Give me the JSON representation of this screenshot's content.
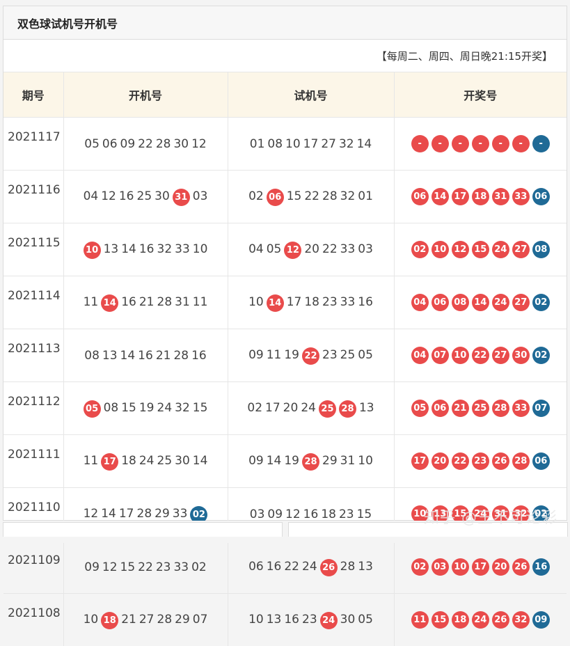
{
  "title": "双色球试机号开机号",
  "notice": "【每周二、周四、周日晚21:15开奖】",
  "headers": [
    "期号",
    "开机号",
    "试机号",
    "开奖号"
  ],
  "rows": [
    {
      "issue": "2021117",
      "kaiji": [
        {
          "n": "05"
        },
        {
          "n": "06"
        },
        {
          "n": "09"
        },
        {
          "n": "22"
        },
        {
          "n": "28"
        },
        {
          "n": "30"
        },
        {
          "n": "12"
        }
      ],
      "shiji": [
        {
          "n": "01"
        },
        {
          "n": "08"
        },
        {
          "n": "10"
        },
        {
          "n": "17"
        },
        {
          "n": "27"
        },
        {
          "n": "32"
        },
        {
          "n": "14"
        }
      ],
      "kaijiang": [
        "-",
        "-",
        "-",
        "-",
        "-",
        "-"
      ],
      "blue": "-"
    },
    {
      "issue": "2021116",
      "kaiji": [
        {
          "n": "04"
        },
        {
          "n": "12"
        },
        {
          "n": "16"
        },
        {
          "n": "25"
        },
        {
          "n": "30"
        },
        {
          "n": "31",
          "h": "red"
        },
        {
          "n": "03"
        }
      ],
      "shiji": [
        {
          "n": "02"
        },
        {
          "n": "06",
          "h": "red"
        },
        {
          "n": "15"
        },
        {
          "n": "22"
        },
        {
          "n": "28"
        },
        {
          "n": "32"
        },
        {
          "n": "01"
        }
      ],
      "kaijiang": [
        "06",
        "14",
        "17",
        "18",
        "31",
        "33"
      ],
      "blue": "06"
    },
    {
      "issue": "2021115",
      "kaiji": [
        {
          "n": "10",
          "h": "red"
        },
        {
          "n": "13"
        },
        {
          "n": "14"
        },
        {
          "n": "16"
        },
        {
          "n": "32"
        },
        {
          "n": "33"
        },
        {
          "n": "10"
        }
      ],
      "shiji": [
        {
          "n": "04"
        },
        {
          "n": "05"
        },
        {
          "n": "12",
          "h": "red"
        },
        {
          "n": "20"
        },
        {
          "n": "22"
        },
        {
          "n": "33"
        },
        {
          "n": "03"
        }
      ],
      "kaijiang": [
        "02",
        "10",
        "12",
        "15",
        "24",
        "27"
      ],
      "blue": "08"
    },
    {
      "issue": "2021114",
      "kaiji": [
        {
          "n": "11"
        },
        {
          "n": "14",
          "h": "red"
        },
        {
          "n": "16"
        },
        {
          "n": "21"
        },
        {
          "n": "28"
        },
        {
          "n": "31"
        },
        {
          "n": "11"
        }
      ],
      "shiji": [
        {
          "n": "10"
        },
        {
          "n": "14",
          "h": "red"
        },
        {
          "n": "17"
        },
        {
          "n": "18"
        },
        {
          "n": "23"
        },
        {
          "n": "33"
        },
        {
          "n": "16"
        }
      ],
      "kaijiang": [
        "04",
        "06",
        "08",
        "14",
        "24",
        "27"
      ],
      "blue": "02"
    },
    {
      "issue": "2021113",
      "kaiji": [
        {
          "n": "08"
        },
        {
          "n": "13"
        },
        {
          "n": "14"
        },
        {
          "n": "16"
        },
        {
          "n": "21"
        },
        {
          "n": "28"
        },
        {
          "n": "16"
        }
      ],
      "shiji": [
        {
          "n": "09"
        },
        {
          "n": "11"
        },
        {
          "n": "19"
        },
        {
          "n": "22",
          "h": "red"
        },
        {
          "n": "23"
        },
        {
          "n": "25"
        },
        {
          "n": "05"
        }
      ],
      "kaijiang": [
        "04",
        "07",
        "10",
        "22",
        "27",
        "30"
      ],
      "blue": "02"
    },
    {
      "issue": "2021112",
      "kaiji": [
        {
          "n": "05",
          "h": "red"
        },
        {
          "n": "08"
        },
        {
          "n": "15"
        },
        {
          "n": "19"
        },
        {
          "n": "24"
        },
        {
          "n": "32"
        },
        {
          "n": "15"
        }
      ],
      "shiji": [
        {
          "n": "02"
        },
        {
          "n": "17"
        },
        {
          "n": "20"
        },
        {
          "n": "24"
        },
        {
          "n": "25",
          "h": "red"
        },
        {
          "n": "28",
          "h": "red"
        },
        {
          "n": "13"
        }
      ],
      "kaijiang": [
        "05",
        "06",
        "21",
        "25",
        "28",
        "33"
      ],
      "blue": "07"
    },
    {
      "issue": "2021111",
      "kaiji": [
        {
          "n": "11"
        },
        {
          "n": "17",
          "h": "red"
        },
        {
          "n": "18"
        },
        {
          "n": "24"
        },
        {
          "n": "25"
        },
        {
          "n": "30"
        },
        {
          "n": "14"
        }
      ],
      "shiji": [
        {
          "n": "09"
        },
        {
          "n": "14"
        },
        {
          "n": "19"
        },
        {
          "n": "28",
          "h": "red"
        },
        {
          "n": "29"
        },
        {
          "n": "31"
        },
        {
          "n": "10"
        }
      ],
      "kaijiang": [
        "17",
        "20",
        "22",
        "23",
        "26",
        "28"
      ],
      "blue": "06"
    },
    {
      "issue": "2021110",
      "kaiji": [
        {
          "n": "12"
        },
        {
          "n": "14"
        },
        {
          "n": "17"
        },
        {
          "n": "28"
        },
        {
          "n": "29"
        },
        {
          "n": "33"
        },
        {
          "n": "02",
          "h": "blue"
        }
      ],
      "shiji": [
        {
          "n": "03"
        },
        {
          "n": "09"
        },
        {
          "n": "12"
        },
        {
          "n": "16"
        },
        {
          "n": "18"
        },
        {
          "n": "23"
        },
        {
          "n": "15"
        }
      ],
      "kaijiang": [
        "10",
        "13",
        "15",
        "24",
        "31",
        "32"
      ],
      "blue": "02"
    },
    {
      "issue": "2021109",
      "kaiji": [
        {
          "n": "09"
        },
        {
          "n": "12"
        },
        {
          "n": "15"
        },
        {
          "n": "22"
        },
        {
          "n": "23"
        },
        {
          "n": "33"
        },
        {
          "n": "02"
        }
      ],
      "shiji": [
        {
          "n": "06"
        },
        {
          "n": "16"
        },
        {
          "n": "22"
        },
        {
          "n": "24"
        },
        {
          "n": "26",
          "h": "red"
        },
        {
          "n": "28"
        },
        {
          "n": "13"
        }
      ],
      "kaijiang": [
        "02",
        "03",
        "10",
        "17",
        "20",
        "26"
      ],
      "blue": "16"
    },
    {
      "issue": "2021108",
      "kaiji": [
        {
          "n": "10"
        },
        {
          "n": "18",
          "h": "red"
        },
        {
          "n": "21"
        },
        {
          "n": "27"
        },
        {
          "n": "28"
        },
        {
          "n": "29"
        },
        {
          "n": "07"
        }
      ],
      "shiji": [
        {
          "n": "10"
        },
        {
          "n": "13"
        },
        {
          "n": "16"
        },
        {
          "n": "23"
        },
        {
          "n": "24",
          "h": "red"
        },
        {
          "n": "30"
        },
        {
          "n": "05"
        }
      ],
      "kaijiang": [
        "11",
        "15",
        "18",
        "24",
        "26",
        "32"
      ],
      "blue": "09"
    }
  ],
  "watermark": "知乎 @王不可论彩",
  "colors": {
    "red": "#e94b4b",
    "blue": "#1f6a96",
    "header_bg": "#fcf6e8"
  }
}
